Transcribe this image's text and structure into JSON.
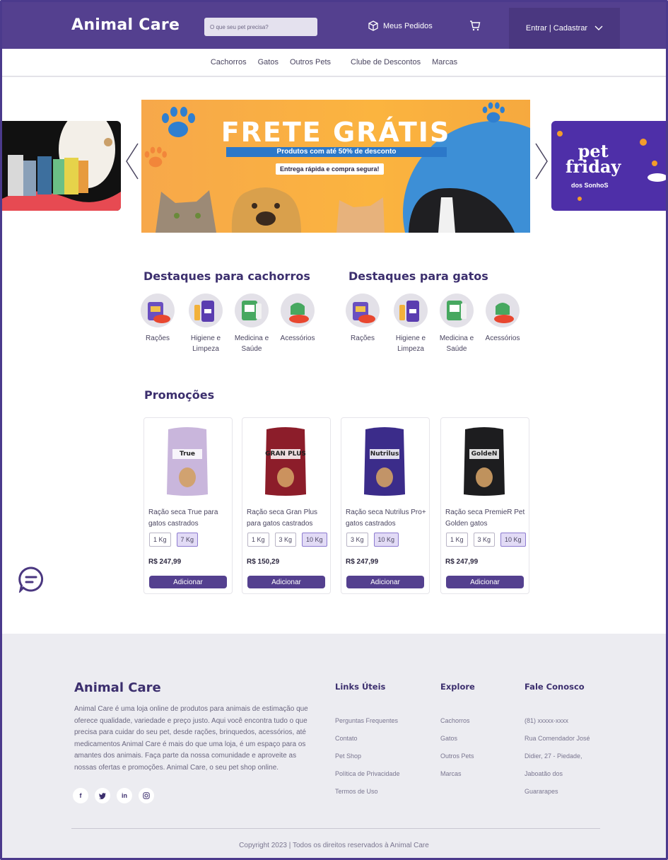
{
  "header": {
    "logo": "Animal Care",
    "search_placeholder": "O que seu pet precisa?",
    "orders_label": "Meus Pedidos",
    "login_label": "Entrar | Cadastrar"
  },
  "nav": {
    "items": [
      "Cachorros",
      "Gatos",
      "Outros Pets",
      "Clube de Descontos",
      "Marcas"
    ]
  },
  "banner": {
    "title": "FRETE GRÁTIS",
    "subtitle": "Produtos com até 50% de desconto",
    "tag": "Entrega rápida e compra segura!",
    "right_title_1": "pet",
    "right_title_2": "friday",
    "right_sub": "dos SonhoS"
  },
  "dogs": {
    "title": "Destaques para cachorros",
    "categories": [
      {
        "label": "Rações"
      },
      {
        "label": "Higiene e Limpeza"
      },
      {
        "label": "Medicina e Saúde"
      },
      {
        "label": "Acessórios"
      }
    ]
  },
  "cats": {
    "title": "Destaques para gatos",
    "categories": [
      {
        "label": "Rações"
      },
      {
        "label": "Higiene e Limpeza"
      },
      {
        "label": "Medicina e Saúde"
      },
      {
        "label": "Acessórios"
      }
    ]
  },
  "promo": {
    "title": "Promoções",
    "add_label": "Adicionar",
    "products": [
      {
        "name": "Ração seca True para gatos castrados",
        "sizes": [
          "1 Kg",
          "7 Kg"
        ],
        "selected": "7 Kg",
        "price": "R$ 247,99",
        "brand": "True",
        "color": "#c9b6dc"
      },
      {
        "name": "Ração seca Gran Plus para gatos castrados",
        "sizes": [
          "1 Kg",
          "3 Kg",
          "10 Kg"
        ],
        "selected": "10 Kg",
        "price": "R$ 150,29",
        "brand": "GRAN PLUS",
        "color": "#8c1d2a"
      },
      {
        "name": "Ração seca Nutrilus Pro+ gatos castrados",
        "sizes": [
          "3 Kg",
          "10 Kg"
        ],
        "selected": "10 Kg",
        "price": "R$ 247,99",
        "brand": "Nutrilus",
        "color": "#3b2c8a"
      },
      {
        "name": "Ração seca PremieR Pet Golden gatos",
        "sizes": [
          "1 Kg",
          "3 Kg",
          "10 Kg"
        ],
        "selected": "10 Kg",
        "price": "R$ 247,99",
        "brand": "GoldeN",
        "color": "#1d1d1f"
      }
    ]
  },
  "footer": {
    "logo": "Animal Care",
    "about": "Animal Care é uma loja online de produtos para animais de estimação que oferece qualidade, variedade e preço justo. Aqui você encontra tudo o que precisa para cuidar do seu pet, desde rações, brinquedos, acessórios, até medicamentos Animal Care é mais do que uma loja, é um espaço para os amantes dos animais. Faça parte da nossa comunidade e aproveite as nossas ofertas e promoções. Animal Care, o seu pet shop online.",
    "links_title": "Links Úteis",
    "links": [
      "Perguntas Frequentes",
      "Contato",
      "Pet Shop",
      "Política de Privacidade",
      "Termos de Uso"
    ],
    "explore_title": "Explore",
    "explore": [
      "Cachorros",
      "Gatos",
      "Outros Pets",
      "Marcas"
    ],
    "contact_title": "Fale Conosco",
    "contact": [
      "(81) xxxxx-xxxx",
      "Rua Comendador José",
      "Didier, 27 - Piedade,",
      "Jaboatão dos",
      "Guararapes"
    ],
    "copyright": "Copyright 2023 | Todos os direitos reservados à Animal Care"
  }
}
